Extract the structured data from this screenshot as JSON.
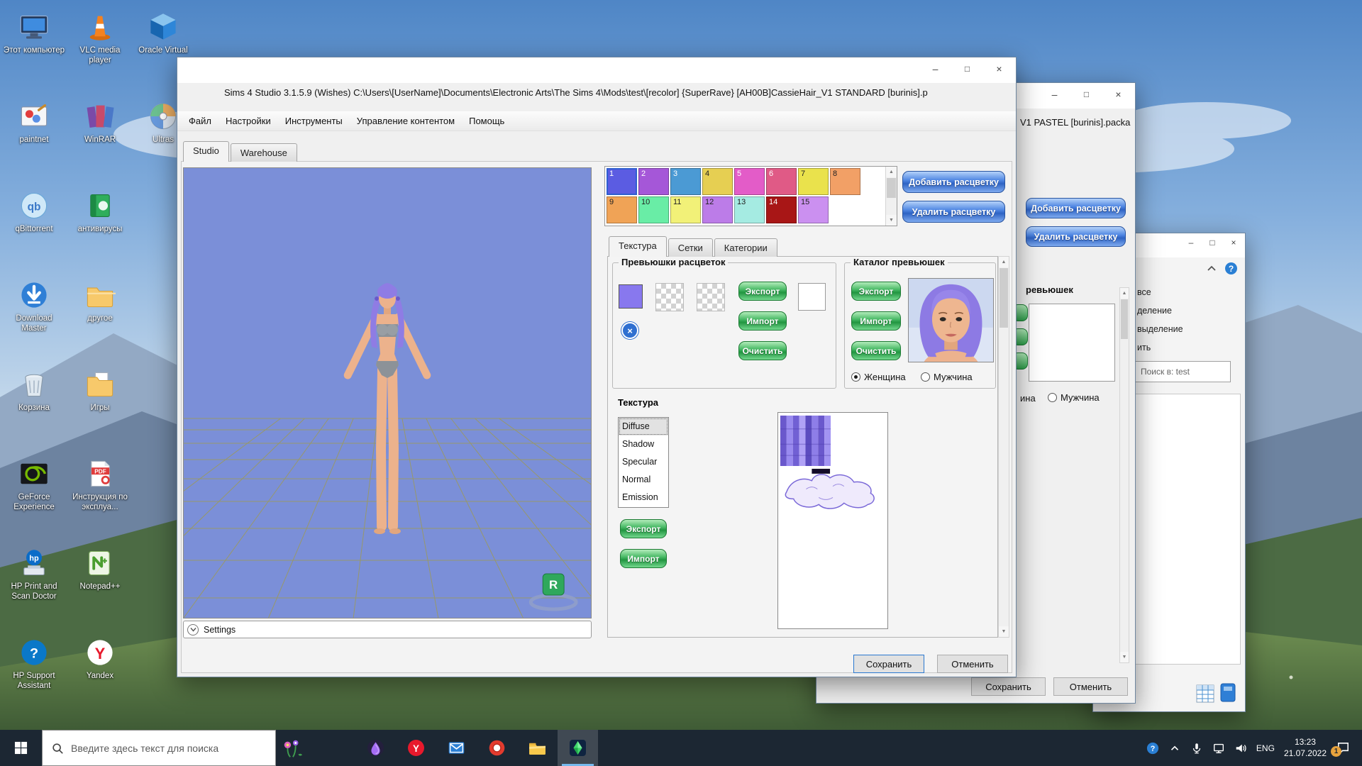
{
  "desktop": {
    "columns": [
      {
        "icons": [
          {
            "type": "this-pc",
            "label": "Этот компьютер"
          },
          {
            "type": "paintnet",
            "label": "paintnet"
          },
          {
            "type": "qbittorrent",
            "label": "qBittorrent"
          },
          {
            "type": "download-master",
            "label": "Download Master"
          },
          {
            "type": "recycle-bin",
            "label": "Корзина"
          },
          {
            "type": "geforce",
            "label": "GeForce Experience"
          },
          {
            "type": "hp-print",
            "label": "HP Print and Scan Doctor"
          },
          {
            "type": "hp-support",
            "label": "HP Support Assistant"
          }
        ]
      },
      {
        "icons": [
          {
            "type": "vlc",
            "label": "VLC media player"
          },
          {
            "type": "winrar",
            "label": "WinRAR"
          },
          {
            "type": "antivirus",
            "label": "антивирусы"
          },
          {
            "type": "folder",
            "label": "другое"
          },
          {
            "type": "games-folder",
            "label": "Игры"
          },
          {
            "type": "pdf",
            "label": "Инструкция по эксплуа..."
          },
          {
            "type": "notepadpp",
            "label": "Notepad++"
          },
          {
            "type": "yandex",
            "label": "Yandex"
          }
        ]
      },
      {
        "icons": [
          {
            "type": "virtualbox",
            "label": "Oracle Virtual"
          },
          {
            "type": "ultraiso",
            "label": "Ultras"
          }
        ]
      }
    ]
  },
  "win1": {
    "title": "Sims 4 Studio 3.1.5.9 (Wishes)  C:\\Users\\[UserName]\\Documents\\Electronic Arts\\The Sims 4\\Mods\\test\\[recolor] {SuperRave} [AH00B]CassieHair_V1 STANDARD [burinis].p",
    "menu": [
      "Файл",
      "Настройки",
      "Инструменты",
      "Управление контентом",
      "Помощь"
    ],
    "tabs": [
      {
        "label": "Studio",
        "active": true
      },
      {
        "label": "Warehouse",
        "active": false
      }
    ],
    "swatches": [
      {
        "n": "1",
        "c": "#5b5ce2",
        "t": "#ffffff",
        "sel": true
      },
      {
        "n": "2",
        "c": "#a557d8",
        "t": "#ffffff"
      },
      {
        "n": "3",
        "c": "#4b9ad4",
        "t": "#ffffff"
      },
      {
        "n": "4",
        "c": "#e6cf52",
        "t": "#222222"
      },
      {
        "n": "5",
        "c": "#e35cc8",
        "t": "#ffffff"
      },
      {
        "n": "6",
        "c": "#e05a86",
        "t": "#ffffff"
      },
      {
        "n": "7",
        "c": "#eae24c",
        "t": "#222222"
      },
      {
        "n": "8",
        "c": "#f2a066",
        "t": "#222222"
      },
      {
        "n": "9",
        "c": "#f0a356",
        "t": "#222222"
      },
      {
        "n": "10",
        "c": "#69eda6",
        "t": "#222222"
      },
      {
        "n": "11",
        "c": "#f2f178",
        "t": "#222222"
      },
      {
        "n": "12",
        "c": "#bc7ce8",
        "t": "#222222"
      },
      {
        "n": "13",
        "c": "#a5ebe2",
        "t": "#222222"
      },
      {
        "n": "14",
        "c": "#a81616",
        "t": "#ffffff"
      },
      {
        "n": "15",
        "c": "#cb90f0",
        "t": "#222222"
      }
    ],
    "add_color": "Добавить расцветку",
    "remove_color": "Удалить расцветку",
    "subtabs": [
      {
        "label": "Текстура",
        "active": true
      },
      {
        "label": "Сетки",
        "active": false
      },
      {
        "label": "Категории",
        "active": false
      }
    ],
    "group_previews": {
      "title": "Превьюшки расцветок",
      "export": "Экспорт",
      "import": "Импорт",
      "clear": "Очистить"
    },
    "group_catalog": {
      "title": "Каталог превьюшек",
      "export": "Экспорт",
      "import": "Импорт",
      "clear": "Очистить",
      "radio_female": "Женщина",
      "radio_male": "Мужчина"
    },
    "texture": {
      "title": "Текстура",
      "items": [
        "Diffuse",
        "Shadow",
        "Specular",
        "Normal",
        "Emission"
      ],
      "selected": "Diffuse",
      "export": "Экспорт",
      "import": "Импорт"
    },
    "viewport": {
      "settings": "Settings",
      "badge": "R"
    },
    "save": "Сохранить",
    "cancel": "Отменить"
  },
  "win2": {
    "title_fragment": "V1 PASTEL [burinis].packa",
    "add_color": "Добавить расцветку",
    "remove_color": "Удалить расцветку",
    "label_fragment": "ревьюшек",
    "radio_fragment": "ина",
    "radio_male": "Мужчина",
    "save": "Сохранить",
    "cancel": "Отменить"
  },
  "win3": {
    "items": [
      "все",
      "деление",
      "выделение",
      "ить"
    ],
    "search": "Поиск в: test"
  },
  "taskbar": {
    "search_placeholder": "Введите здесь текст для поиска",
    "apps": [
      {
        "name": "purple-drop-app"
      },
      {
        "name": "yandex-browser"
      },
      {
        "name": "mail"
      },
      {
        "name": "red-circle-app"
      },
      {
        "name": "file-explorer"
      },
      {
        "name": "sims4",
        "active": true
      }
    ],
    "tray": [
      "tray-help",
      "chevron-up",
      "microphone",
      "network",
      "volume"
    ],
    "lang": "ENG",
    "time": "13:23",
    "date": "21.07.2022",
    "badge": "1"
  }
}
